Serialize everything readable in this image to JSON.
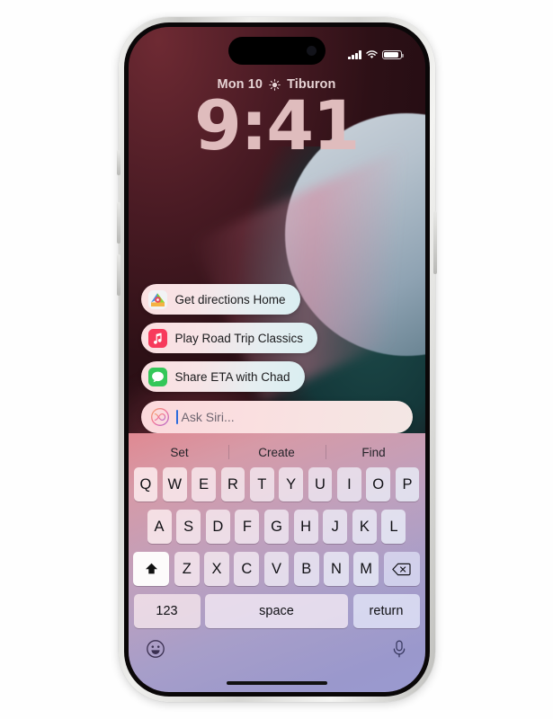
{
  "device": {
    "name": "iphone-15-pro",
    "frame_color": "#d6d6d3"
  },
  "status_bar": {
    "signal_icon": "cellular-signal-icon",
    "wifi_icon": "wifi-icon",
    "battery_icon": "battery-icon"
  },
  "lock_screen": {
    "date": "Mon 10",
    "weather_icon": "sun-icon",
    "location": "Tiburon",
    "time": "9:41"
  },
  "siri": {
    "suggestions": [
      {
        "label": "Get directions Home",
        "icon": "maps-app-icon"
      },
      {
        "label": "Play Road Trip Classics",
        "icon": "music-app-icon"
      },
      {
        "label": "Share ETA with Chad",
        "icon": "messages-app-icon"
      }
    ],
    "input": {
      "icon": "siri-icon",
      "value": "",
      "placeholder": "Ask Siri..."
    }
  },
  "keyboard": {
    "predictions": [
      "Set",
      "Create",
      "Find"
    ],
    "row1": [
      "Q",
      "W",
      "E",
      "R",
      "T",
      "Y",
      "U",
      "I",
      "O",
      "P"
    ],
    "row2": [
      "A",
      "S",
      "D",
      "F",
      "G",
      "H",
      "J",
      "K",
      "L"
    ],
    "row3": [
      "Z",
      "X",
      "C",
      "V",
      "B",
      "N",
      "M"
    ],
    "shift_icon": "shift-icon",
    "delete_icon": "delete-backward-icon",
    "numbers_label": "123",
    "space_label": "space",
    "return_label": "return",
    "emoji_icon": "emoji-icon",
    "dictation_icon": "microphone-icon"
  },
  "colors": {
    "accent_pink": "#e08992",
    "accent_blue": "#9a9ad0",
    "caret": "#2e6bdc",
    "clock_text": "#dfbcbd"
  }
}
